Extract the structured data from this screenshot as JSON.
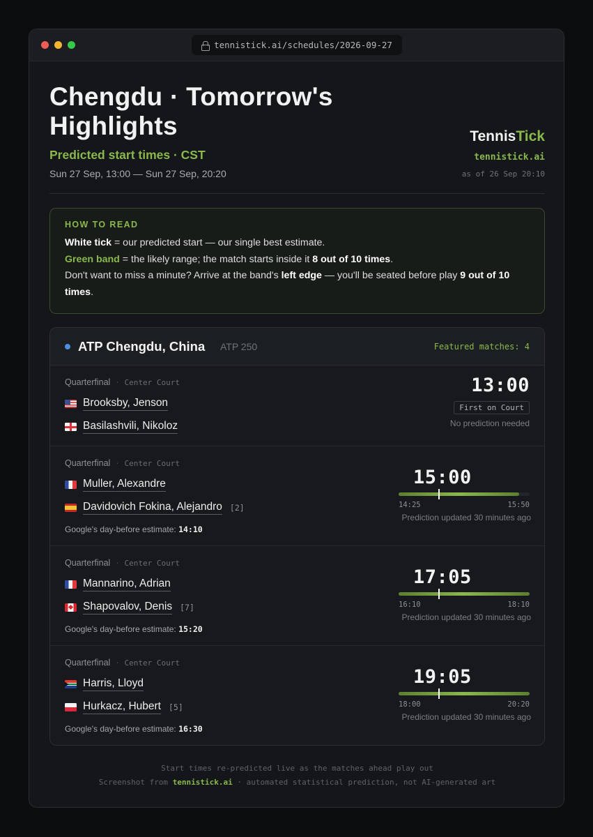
{
  "browser": {
    "url": "tennistick.ai/schedules/2026-09-27"
  },
  "header": {
    "title": "Chengdu · Tomorrow's Highlights",
    "subtitle": "Predicted start times · CST",
    "range": "Sun 27 Sep, 13:00 — Sun 27 Sep, 20:20"
  },
  "brand": {
    "name_main": "Tennis",
    "name_accent": "Tick",
    "url": "tennistick.ai",
    "as_of": "as of 26 Sep 20:10"
  },
  "howto": {
    "title": "HOW TO READ",
    "l1_b": "White tick",
    "l1_t": " = our predicted start — our single best estimate.",
    "l2_g": "Green band",
    "l2_t": " = the likely range; the match starts inside it ",
    "l2_b": "8 out of 10 times",
    "l2_end": ".",
    "l3_t1": "Don't want to miss a minute? Arrive at the band's ",
    "l3_b1": "left edge",
    "l3_t2": " — you'll be seated before play ",
    "l3_b2": "9 out of 10 times",
    "l3_end": "."
  },
  "tournament": {
    "name": "ATP Chengdu, China",
    "category": "ATP 250",
    "featured": "Featured matches: 4"
  },
  "matches": [
    {
      "round": "Quarterfinal",
      "court": "Center Court",
      "p1": {
        "name": "Brooksby, Jenson",
        "flag": "us"
      },
      "p2": {
        "name": "Basilashvili, Nikoloz",
        "flag": "ge"
      },
      "time": "13:00",
      "badge": "First on Court",
      "note": "No prediction needed"
    },
    {
      "round": "Quarterfinal",
      "court": "Center Court",
      "p1": {
        "name": "Muller, Alexandre",
        "flag": "fr"
      },
      "p2": {
        "name": "Davidovich Fokina, Alejandro",
        "flag": "es",
        "seed": "[2]"
      },
      "google_label": "Google's day-before estimate:",
      "google_time": "14:10",
      "time": "15:00",
      "band_start": "14:25",
      "band_end": "15:50",
      "band_left_frac": 0.0,
      "band_right_frac": 0.92,
      "tick_frac": 0.31,
      "updated": "Prediction updated 30 minutes ago"
    },
    {
      "round": "Quarterfinal",
      "court": "Center Court",
      "p1": {
        "name": "Mannarino, Adrian",
        "flag": "fr"
      },
      "p2": {
        "name": "Shapovalov, Denis",
        "flag": "ca",
        "seed": "[7]"
      },
      "google_label": "Google's day-before estimate:",
      "google_time": "15:20",
      "time": "17:05",
      "band_start": "16:10",
      "band_end": "18:10",
      "band_left_frac": 0.0,
      "band_right_frac": 1.0,
      "tick_frac": 0.31,
      "updated": "Prediction updated 30 minutes ago"
    },
    {
      "round": "Quarterfinal",
      "court": "Center Court",
      "p1": {
        "name": "Harris, Lloyd",
        "flag": "za"
      },
      "p2": {
        "name": "Hurkacz, Hubert",
        "flag": "pl",
        "seed": "[5]"
      },
      "google_label": "Google's day-before estimate:",
      "google_time": "16:30",
      "time": "19:05",
      "band_start": "18:00",
      "band_end": "20:20",
      "band_left_frac": 0.0,
      "band_right_frac": 1.0,
      "tick_frac": 0.31,
      "updated": "Prediction updated 30 minutes ago"
    }
  ],
  "footer": {
    "line1": "Start times re-predicted live as the matches ahead play out",
    "line2_a": "Screenshot from ",
    "line2_link": "tennistick.ai",
    "line2_b": " · automated statistical prediction, not AI-generated art"
  }
}
